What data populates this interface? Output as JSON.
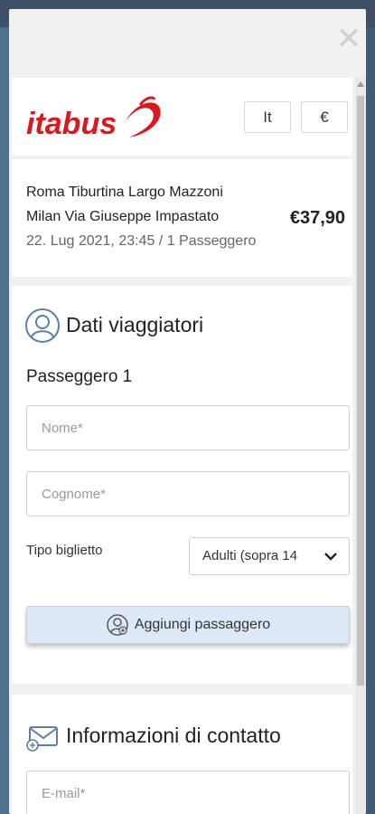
{
  "header": {
    "close_icon": "close-icon",
    "logo_text": "itabus",
    "language_label": "It",
    "currency_label": "€",
    "brand_color": "#d71920"
  },
  "summary": {
    "from": "Roma Tiburtina Largo Mazzoni",
    "to": "Milan Via Giuseppe Impastato",
    "meta": "22. Lug 2021, 23:45 / 1 Passeggero",
    "price": "€37,90"
  },
  "travelers": {
    "title": "Dati viaggiatori",
    "passenger_label": "Passeggero  1",
    "first_name_placeholder": "Nome*",
    "last_name_placeholder": "Cognome*",
    "ticket_type_label": "Tipo biglietto",
    "ticket_type_value": "Adulti (sopra 14",
    "add_passenger_label": "Aggiungi passaggero",
    "add_button_color": "#dde8f6"
  },
  "contact": {
    "title": "Informazioni di contatto",
    "email_placeholder": "E-mail*"
  }
}
